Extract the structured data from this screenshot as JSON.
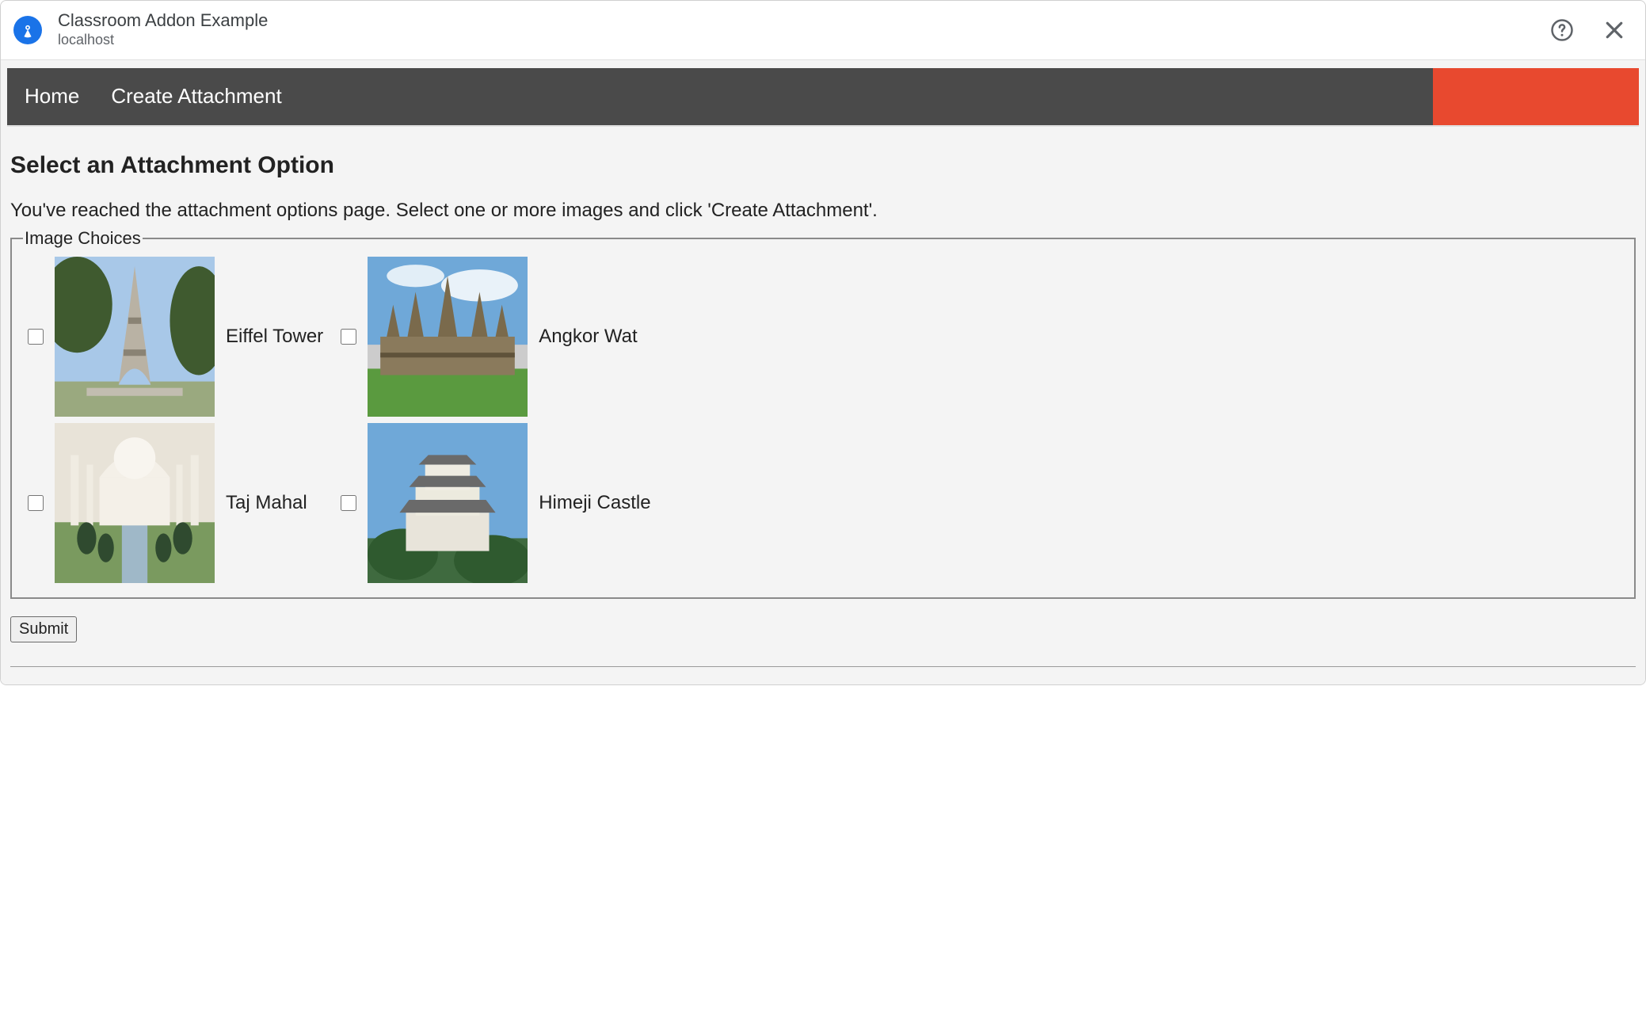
{
  "titlebar": {
    "title": "Classroom Addon Example",
    "subtitle": "localhost"
  },
  "nav": {
    "links": [
      "Home",
      "Create Attachment"
    ]
  },
  "page": {
    "heading": "Select an Attachment Option",
    "instructions": "You've reached the attachment options page. Select one or more images and click 'Create Attachment'.",
    "fieldset_legend": "Image Choices",
    "submit_label": "Submit"
  },
  "choices": [
    {
      "label": "Eiffel Tower",
      "icon": "eiffel-tower",
      "checked": false
    },
    {
      "label": "Angkor Wat",
      "icon": "angkor-wat",
      "checked": false
    },
    {
      "label": "Taj Mahal",
      "icon": "taj-mahal",
      "checked": false
    },
    {
      "label": "Himeji Castle",
      "icon": "himeji-castle",
      "checked": false
    }
  ]
}
